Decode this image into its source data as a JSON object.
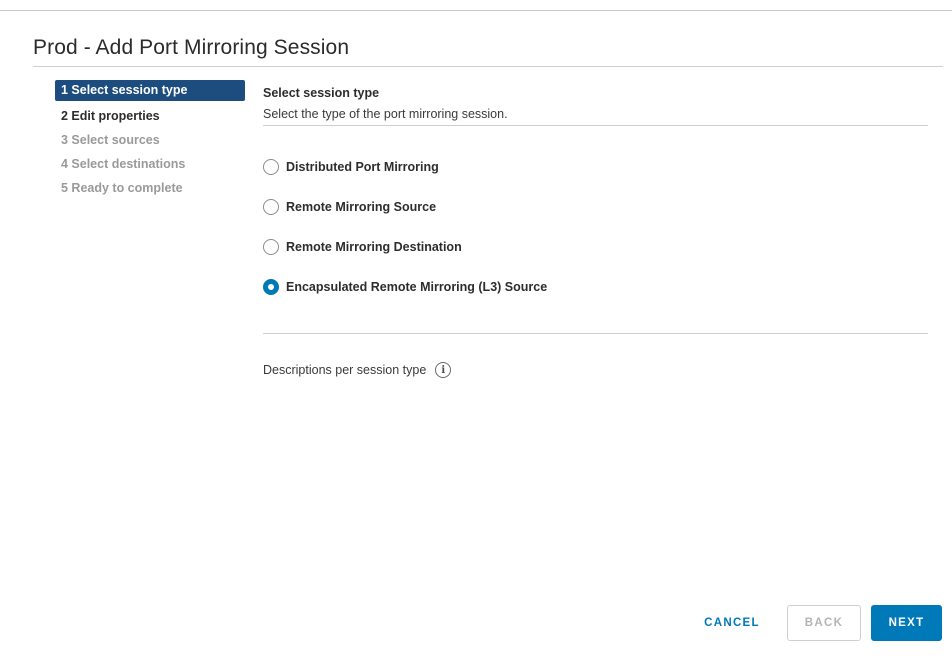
{
  "dialog": {
    "title": "Prod - Add Port Mirroring Session"
  },
  "steps": [
    {
      "label": "1 Select session type",
      "state": "active"
    },
    {
      "label": "2 Edit properties",
      "state": "done"
    },
    {
      "label": "3 Select sources",
      "state": "pending"
    },
    {
      "label": "4 Select destinations",
      "state": "pending"
    },
    {
      "label": "5 Ready to complete",
      "state": "pending"
    }
  ],
  "content": {
    "heading": "Select session type",
    "description": "Select the type of the port mirroring session.",
    "options": [
      {
        "label": "Distributed Port Mirroring",
        "checked": false
      },
      {
        "label": "Remote Mirroring Source",
        "checked": false
      },
      {
        "label": "Remote Mirroring Destination",
        "checked": false
      },
      {
        "label": "Encapsulated Remote Mirroring (L3) Source",
        "checked": true
      }
    ],
    "descriptions_link": "Descriptions per session type",
    "info_icon": "info-icon",
    "info_glyph": "i"
  },
  "footer": {
    "cancel_label": "CANCEL",
    "back_label": "BACK",
    "next_label": "NEXT"
  },
  "colors": {
    "accent": "#0079b8",
    "active_step_bg": "#1c4d7e",
    "disabled_text": "#9a9a9a"
  }
}
